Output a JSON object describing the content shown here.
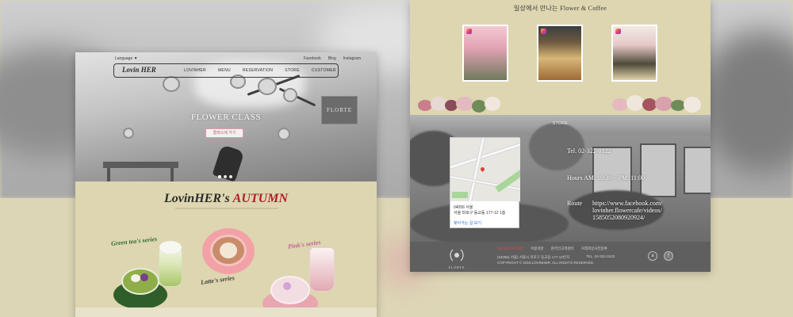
{
  "left_page": {
    "topbar": {
      "language": "Language ▼",
      "links": [
        "Facebook",
        "Blog",
        "Instagram"
      ]
    },
    "logo": "Lovin HER",
    "nav": [
      "LOVINHER",
      "MENU",
      "RESERVATION",
      "STORE",
      "CUSTOMER"
    ],
    "hero": {
      "title": "FLOWER CLASS",
      "button": "클래스에 가기",
      "sign": "FLORTE"
    },
    "season": {
      "brand": "LovinHER's",
      "word": "AUTUMN"
    },
    "series": [
      "Green tea's series",
      "Latte's series",
      "Pink's series"
    ]
  },
  "right_page": {
    "title": "일상에서 만나는 Flower & Coffee",
    "store_label": "STORE",
    "map": {
      "address_lines": [
        "04056 서울",
        "서울 마포구 동교동 177-12 1층"
      ],
      "directions_link": "찾아가는 길 보기"
    },
    "info": {
      "tel": "Tel.   02-322-0122",
      "hours": "Hours    AM. 10:30 ~ PM. 11:00",
      "route_label": "Route",
      "route_lines": [
        "https://www.facebook.com/",
        "lovinher.flowercafe/videos/",
        "1585052080920924/"
      ]
    },
    "footer": {
      "brand": "FLORTE",
      "menu": [
        "개인정보처리방침",
        "이용약관",
        "온라인고객센터",
        "거래희망사전등록"
      ],
      "address": "(04056) 서울) 서울시 마포구 동교동 177-12번지",
      "tel": "TEL. 02-322-0122",
      "copyright": "COPYRIGHT © 2018 LOVINHER. ALL RIGHTS RESERVED.",
      "social": [
        "a",
        "f"
      ]
    }
  }
}
